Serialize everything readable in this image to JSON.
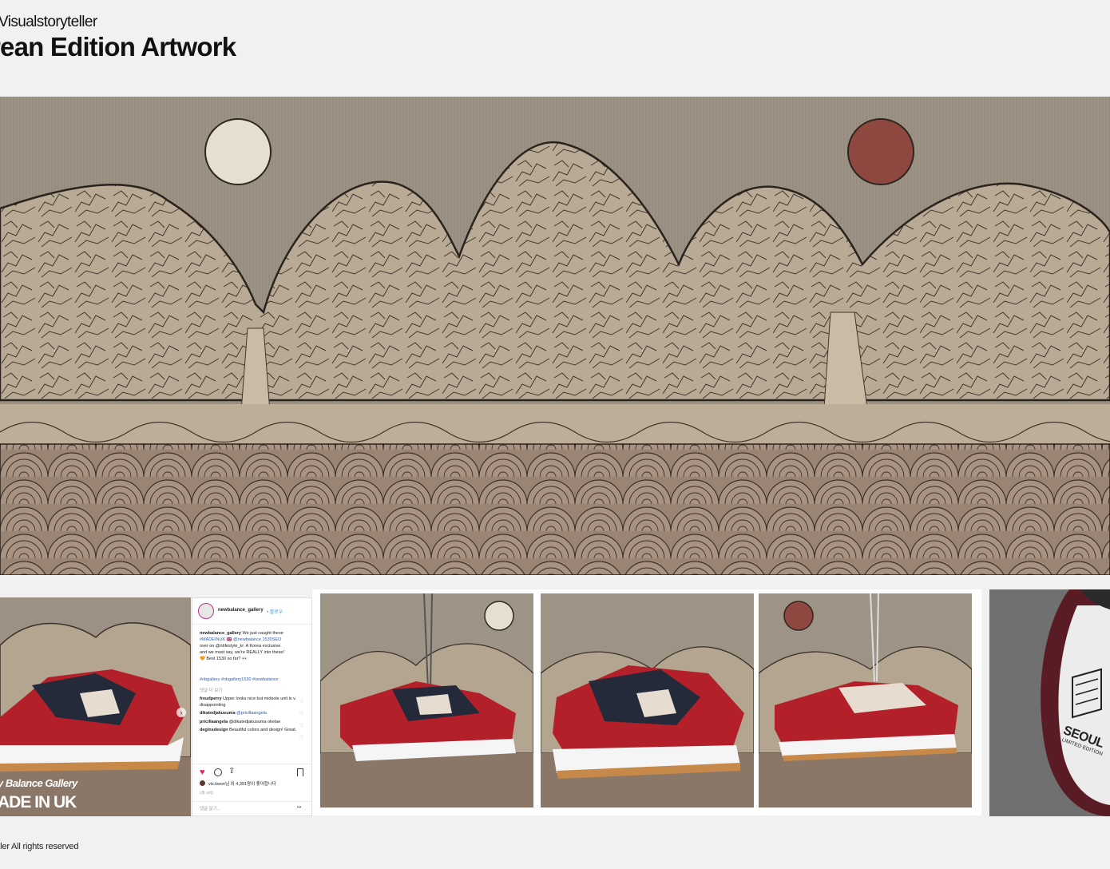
{
  "header": {
    "author": "Visualstoryteller",
    "title": "rean Edition Artwork"
  },
  "gallery_card": {
    "line1": "y Balance  Gallery",
    "line2": "ADE IN UK"
  },
  "instagram": {
    "username": "newbalance_gallery",
    "follow": "• 팔로우",
    "caption_user": "newbalance_gallery",
    "caption_l1": "We just caught these",
    "caption_l2": "#MADEINUK 🇬🇧 @newbalance 1530SEO",
    "caption_l3": "over on @nbfestyle_kr. A Korea exclusive",
    "caption_l4": "and we must say, we're REALLY into these!",
    "caption_l5": "🧡 Best 1530 so far? 👀",
    "tags": "#nbgallery #nbgallery1530 #newbalance",
    "more_comments": "댓글 더 보기",
    "comments": [
      {
        "user": "freudperry",
        "text": "Upper looks nice but midsole unit is v. disappointing"
      },
      {
        "user": "dikatedjakusuma",
        "text": "@pricillaangela"
      },
      {
        "user": "pricillaangela",
        "text": "@dikatedjakusuma okelae"
      },
      {
        "user": "deginsdesign",
        "text": "Beautiful colors and design! Great."
      }
    ],
    "likes": "vis.kwon님 외 4,391명이 좋아합니다",
    "date": "2월 19일",
    "add_comment": "댓글 달기...",
    "more": "•••"
  },
  "insole": {
    "brand": "SEOUL",
    "sub": "LIMITED EDITION"
  },
  "footer": {
    "text": "eller All rights reserved"
  },
  "colors": {
    "background": "#f1f1f1",
    "artwork_sky": "#9c9284",
    "mountain_fill": "#b5a692",
    "wave_fill": "#8a7566",
    "moon_light": "#e4dfcf",
    "sun_red": "#8e4840",
    "shoe_red": "#b3202a",
    "shoe_navy": "#252a3a",
    "like_red": "#e0245e",
    "link_blue": "#2b5db0"
  }
}
